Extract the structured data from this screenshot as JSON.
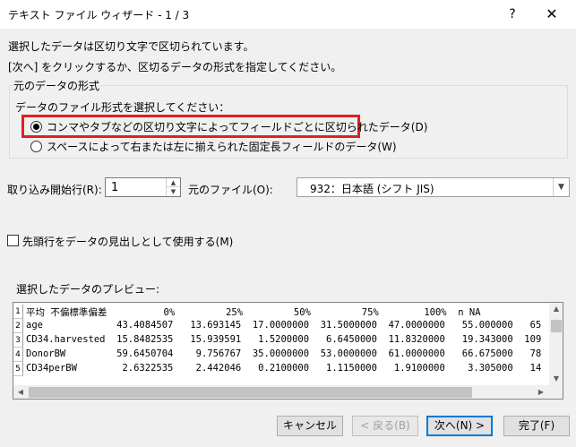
{
  "window": {
    "title": "テキスト ファイル ウィザード - 1 / 3",
    "help_label": "?",
    "close_label": "✕"
  },
  "intro": {
    "line1": "選択したデータは区切り文字で区切られています。",
    "line2": "[次へ] をクリックするか、区切るデータの形式を指定してください。"
  },
  "format_group": {
    "title": "元のデータの形式",
    "prompt": "データのファイル形式を選択してください：",
    "options": [
      {
        "label": "コンマやタブなどの区切り文字によってフィールドごとに区切られたデータ(D)",
        "checked": true
      },
      {
        "label": "スペースによって右または左に揃えられた固定長フィールドのデータ(W)",
        "checked": false
      }
    ]
  },
  "start_row": {
    "label": "取り込み開始行(R):",
    "value": "1"
  },
  "origin": {
    "label": "元のファイル(O):",
    "value": "932：日本語 (シフト JIS)"
  },
  "header_checkbox": {
    "label": "先頭行をデータの見出しとして使用する(M)",
    "checked": false
  },
  "preview": {
    "label": "選択したデータのプレビュー:",
    "rows": [
      {
        "num": "1",
        "text": "平均 不偏標準偏差          0%         25%         50%         75%        100%  n NA"
      },
      {
        "num": "2",
        "text": "age             43.4084507   13.693145  17.0000000  31.5000000  47.0000000   55.000000   65"
      },
      {
        "num": "3",
        "text": "CD34.harvested  15.8482535   15.939591   1.5200000   6.6450000  11.8320000   19.343000  109"
      },
      {
        "num": "4",
        "text": "DonorBW         59.6450704    9.756767  35.0000000  53.0000000  61.0000000   66.675000   78"
      },
      {
        "num": "5",
        "text": "CD34perBW        2.6322535    2.442046   0.2100000   1.1150000   1.9100000    3.305000   14"
      }
    ]
  },
  "buttons": {
    "cancel": "キャンセル",
    "back": "< 戻る(B)",
    "next": "次へ(N) >",
    "finish": "完了(F)"
  }
}
